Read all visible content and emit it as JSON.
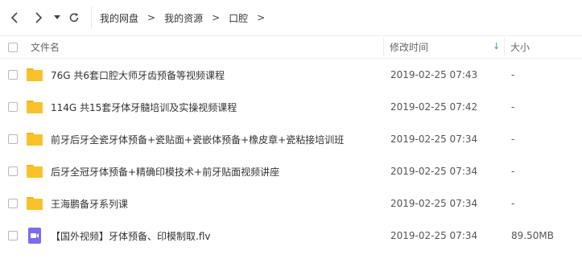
{
  "breadcrumb": {
    "items": [
      "我的网盘",
      "我的资源",
      "口腔"
    ],
    "separator": ">"
  },
  "header": {
    "name_label": "文件名",
    "time_label": "修改时间",
    "size_label": "大小",
    "sort_indicator": "↓"
  },
  "files": [
    {
      "name": "76G 共6套口腔大师牙齿预备等视频课程",
      "modified": "2019-02-25 07:43",
      "size": "-",
      "type": "folder"
    },
    {
      "name": "114G 共15套牙体牙髓培训及实操视频课程",
      "modified": "2019-02-25 07:42",
      "size": "-",
      "type": "folder"
    },
    {
      "name": "前牙后牙全瓷牙体预备+瓷贴面+瓷嵌体预备+橡皮章+瓷粘接培训班",
      "modified": "2019-02-25 07:34",
      "size": "-",
      "type": "folder"
    },
    {
      "name": "后牙全冠牙体预备+精确印模技术+前牙贴面视频讲座",
      "modified": "2019-02-25 07:34",
      "size": "-",
      "type": "folder"
    },
    {
      "name": "王海鹏备牙系列课",
      "modified": "2019-02-25 07:34",
      "size": "-",
      "type": "folder"
    },
    {
      "name": "【国外视频】牙体预备、印模制取.flv",
      "modified": "2019-02-25 07:34",
      "size": "89.50MB",
      "type": "video"
    }
  ],
  "colors": {
    "folder": "#f9c22a",
    "video": "#7a6cf0",
    "sort_accent": "#3b8fe8"
  }
}
